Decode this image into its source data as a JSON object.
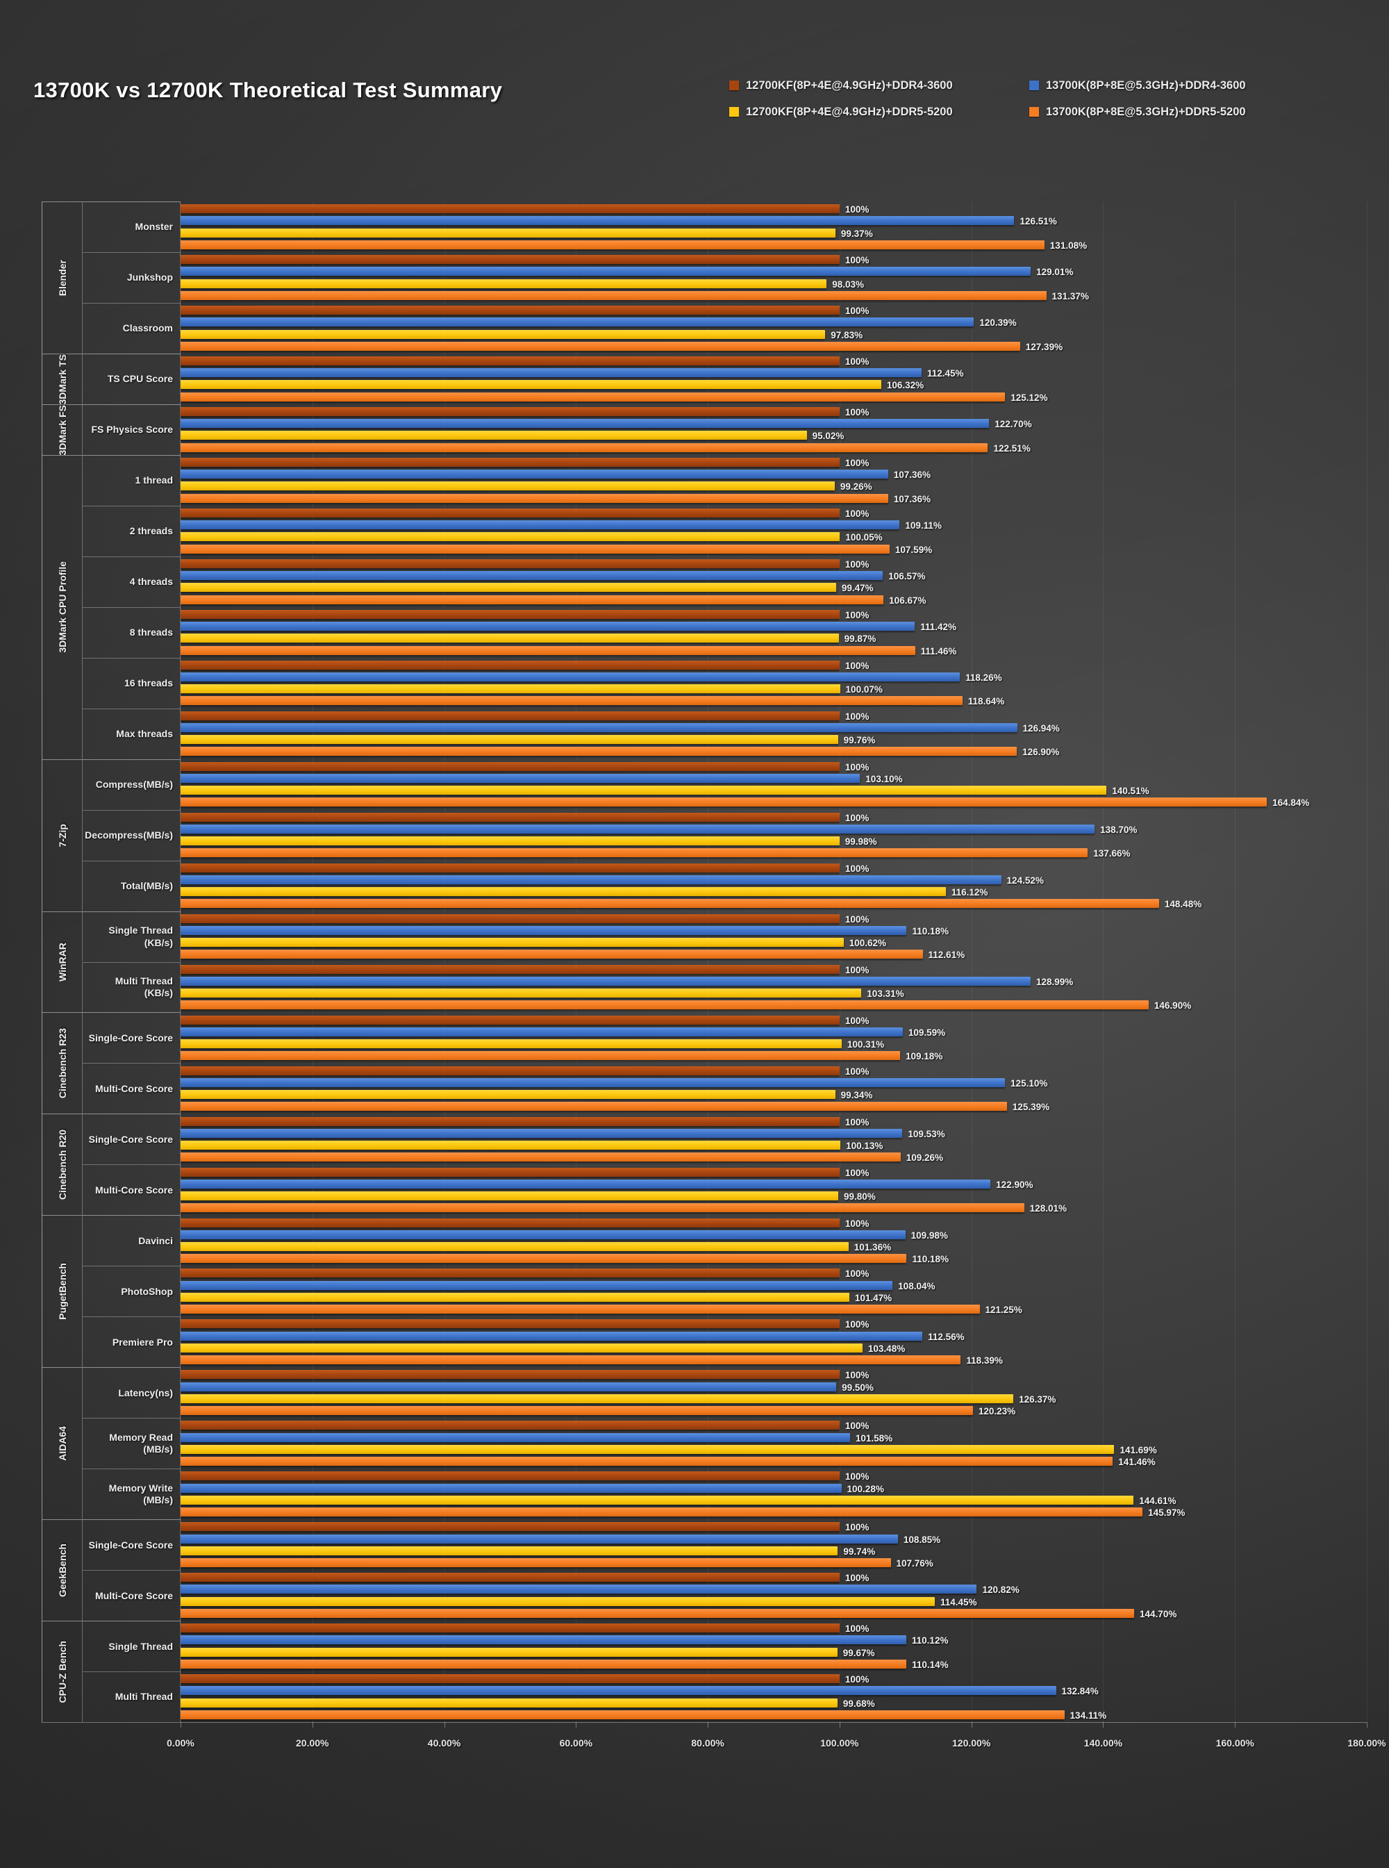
{
  "title": "13700K vs 12700K Theoretical Test Summary",
  "legend": [
    {
      "label": "12700KF(8P+4E@4.9GHz)+DDR4-3600",
      "color": "#a8450f"
    },
    {
      "label": "13700K(8P+8E@5.3GHz)+DDR4-3600",
      "color": "#3d72c9"
    },
    {
      "label": "12700KF(8P+4E@4.9GHz)+DDR5-5200",
      "color": "#fcc70d"
    },
    {
      "label": "13700K(8P+8E@5.3GHz)+DDR5-5200",
      "color": "#f57c20"
    }
  ],
  "axis": {
    "ticks": [
      "0.00%",
      "20.00%",
      "40.00%",
      "60.00%",
      "80.00%",
      "100.00%",
      "120.00%",
      "140.00%",
      "160.00%",
      "180.00%"
    ],
    "min": 0,
    "max": 180,
    "step": 20
  },
  "chart_data": {
    "type": "bar",
    "orientation": "horizontal",
    "title": "13700K vs 12700K Theoretical Test Summary",
    "xlabel": "",
    "ylabel": "",
    "xlim": [
      0,
      180
    ],
    "xunit": "%",
    "grid": true,
    "legend_position": "top-right",
    "series": [
      {
        "name": "12700KF(8P+4E@4.9GHz)+DDR4-3600",
        "color": "#a8450f"
      },
      {
        "name": "13700K(8P+8E@5.3GHz)+DDR4-3600",
        "color": "#3d72c9"
      },
      {
        "name": "12700KF(8P+4E@4.9GHz)+DDR5-5200",
        "color": "#fcc70d"
      },
      {
        "name": "13700K(8P+8E@5.3GHz)+DDR5-5200",
        "color": "#f57c20"
      }
    ],
    "groups": [
      {
        "group": "Blender",
        "rows": [
          {
            "category": "Monster",
            "values": [
              100,
              126.51,
              99.37,
              131.08
            ],
            "labels": [
              "100%",
              "126.51%",
              "99.37%",
              "131.08%"
            ]
          },
          {
            "category": "Junkshop",
            "values": [
              100,
              129.01,
              98.03,
              131.37
            ],
            "labels": [
              "100%",
              "129.01%",
              "98.03%",
              "131.37%"
            ]
          },
          {
            "category": "Classroom",
            "values": [
              100,
              120.39,
              97.83,
              127.39
            ],
            "labels": [
              "100%",
              "120.39%",
              "97.83%",
              "127.39%"
            ]
          }
        ]
      },
      {
        "group": "3DMark TS",
        "rows": [
          {
            "category": "TS CPU Score",
            "values": [
              100,
              112.45,
              106.32,
              125.12
            ],
            "labels": [
              "100%",
              "112.45%",
              "106.32%",
              "125.12%"
            ]
          }
        ]
      },
      {
        "group": "3DMark FS",
        "rows": [
          {
            "category": "FS Physics Score",
            "values": [
              100,
              122.7,
              95.02,
              122.51
            ],
            "labels": [
              "100%",
              "122.70%",
              "95.02%",
              "122.51%"
            ]
          }
        ]
      },
      {
        "group": "3DMark CPU Profile",
        "rows": [
          {
            "category": "1 thread",
            "values": [
              100,
              107.36,
              99.26,
              107.36
            ],
            "labels": [
              "100%",
              "107.36%",
              "99.26%",
              "107.36%"
            ]
          },
          {
            "category": "2 threads",
            "values": [
              100,
              109.11,
              100.05,
              107.59
            ],
            "labels": [
              "100%",
              "109.11%",
              "100.05%",
              "107.59%"
            ]
          },
          {
            "category": "4 threads",
            "values": [
              100,
              106.57,
              99.47,
              106.67
            ],
            "labels": [
              "100%",
              "106.57%",
              "99.47%",
              "106.67%"
            ]
          },
          {
            "category": "8 threads",
            "values": [
              100,
              111.42,
              99.87,
              111.46
            ],
            "labels": [
              "100%",
              "111.42%",
              "99.87%",
              "111.46%"
            ]
          },
          {
            "category": "16 threads",
            "values": [
              100,
              118.26,
              100.07,
              118.64
            ],
            "labels": [
              "100%",
              "118.26%",
              "100.07%",
              "118.64%"
            ]
          },
          {
            "category": "Max threads",
            "values": [
              100,
              126.94,
              99.76,
              126.9
            ],
            "labels": [
              "100%",
              "126.94%",
              "99.76%",
              "126.90%"
            ]
          }
        ]
      },
      {
        "group": "7-Zip",
        "rows": [
          {
            "category": "Compress(MB/s)",
            "values": [
              100,
              103.1,
              140.51,
              164.84
            ],
            "labels": [
              "100%",
              "103.10%",
              "140.51%",
              "164.84%"
            ]
          },
          {
            "category": "Decompress(MB/s)",
            "values": [
              100,
              138.7,
              99.98,
              137.66
            ],
            "labels": [
              "100%",
              "138.70%",
              "99.98%",
              "137.66%"
            ]
          },
          {
            "category": "Total(MB/s)",
            "values": [
              100,
              124.52,
              116.12,
              148.48
            ],
            "labels": [
              "100%",
              "124.52%",
              "116.12%",
              "148.48%"
            ]
          }
        ]
      },
      {
        "group": "WinRAR",
        "rows": [
          {
            "category": "Single Thread\n(KB/s)",
            "values": [
              100,
              110.18,
              100.62,
              112.61
            ],
            "labels": [
              "100%",
              "110.18%",
              "100.62%",
              "112.61%"
            ]
          },
          {
            "category": "Multi Thread\n(KB/s)",
            "values": [
              100,
              128.99,
              103.31,
              146.9
            ],
            "labels": [
              "100%",
              "128.99%",
              "103.31%",
              "146.90%"
            ]
          }
        ]
      },
      {
        "group": "Cinebench R23",
        "rows": [
          {
            "category": "Single-Core Score",
            "values": [
              100,
              109.59,
              100.31,
              109.18
            ],
            "labels": [
              "100%",
              "109.59%",
              "100.31%",
              "109.18%"
            ]
          },
          {
            "category": "Multi-Core Score",
            "values": [
              100,
              125.1,
              99.34,
              125.39
            ],
            "labels": [
              "100%",
              "125.10%",
              "99.34%",
              "125.39%"
            ]
          }
        ]
      },
      {
        "group": "Cinebench R20",
        "rows": [
          {
            "category": "Single-Core Score",
            "values": [
              100,
              109.53,
              100.13,
              109.26
            ],
            "labels": [
              "100%",
              "109.53%",
              "100.13%",
              "109.26%"
            ]
          },
          {
            "category": "Multi-Core Score",
            "values": [
              100,
              122.9,
              99.8,
              128.01
            ],
            "labels": [
              "100%",
              "122.90%",
              "99.80%",
              "128.01%"
            ]
          }
        ]
      },
      {
        "group": "PugetBench",
        "rows": [
          {
            "category": "Davinci",
            "values": [
              100,
              109.98,
              101.36,
              110.18
            ],
            "labels": [
              "100%",
              "109.98%",
              "101.36%",
              "110.18%"
            ]
          },
          {
            "category": "PhotoShop",
            "values": [
              100,
              108.04,
              101.47,
              121.25
            ],
            "labels": [
              "100%",
              "108.04%",
              "101.47%",
              "121.25%"
            ]
          },
          {
            "category": "Premiere Pro",
            "values": [
              100,
              112.56,
              103.48,
              118.39
            ],
            "labels": [
              "100%",
              "112.56%",
              "103.48%",
              "118.39%"
            ]
          }
        ]
      },
      {
        "group": "AIDA64",
        "rows": [
          {
            "category": "Latency(ns)",
            "values": [
              100,
              99.5,
              126.37,
              120.23
            ],
            "labels": [
              "100%",
              "99.50%",
              "126.37%",
              "120.23%"
            ]
          },
          {
            "category": "Memory Read\n(MB/s)",
            "values": [
              100,
              101.58,
              141.69,
              141.46
            ],
            "labels": [
              "100%",
              "101.58%",
              "141.69%",
              "141.46%"
            ]
          },
          {
            "category": "Memory Write\n(MB/s)",
            "values": [
              100,
              100.28,
              144.61,
              145.97
            ],
            "labels": [
              "100%",
              "100.28%",
              "144.61%",
              "145.97%"
            ]
          }
        ]
      },
      {
        "group": "GeekBench",
        "rows": [
          {
            "category": "Single-Core Score",
            "values": [
              100,
              108.85,
              99.74,
              107.76
            ],
            "labels": [
              "100%",
              "108.85%",
              "99.74%",
              "107.76%"
            ]
          },
          {
            "category": "Multi-Core Score",
            "values": [
              100,
              120.82,
              114.45,
              144.7
            ],
            "labels": [
              "100%",
              "120.82%",
              "114.45%",
              "144.70%"
            ]
          }
        ]
      },
      {
        "group": "CPU-Z Bench",
        "rows": [
          {
            "category": "Single Thread",
            "values": [
              100,
              110.12,
              99.67,
              110.14
            ],
            "labels": [
              "100%",
              "110.12%",
              "99.67%",
              "110.14%"
            ]
          },
          {
            "category": "Multi Thread",
            "values": [
              100,
              132.84,
              99.68,
              134.11
            ],
            "labels": [
              "100%",
              "132.84%",
              "99.68%",
              "134.11%"
            ]
          }
        ]
      }
    ]
  }
}
